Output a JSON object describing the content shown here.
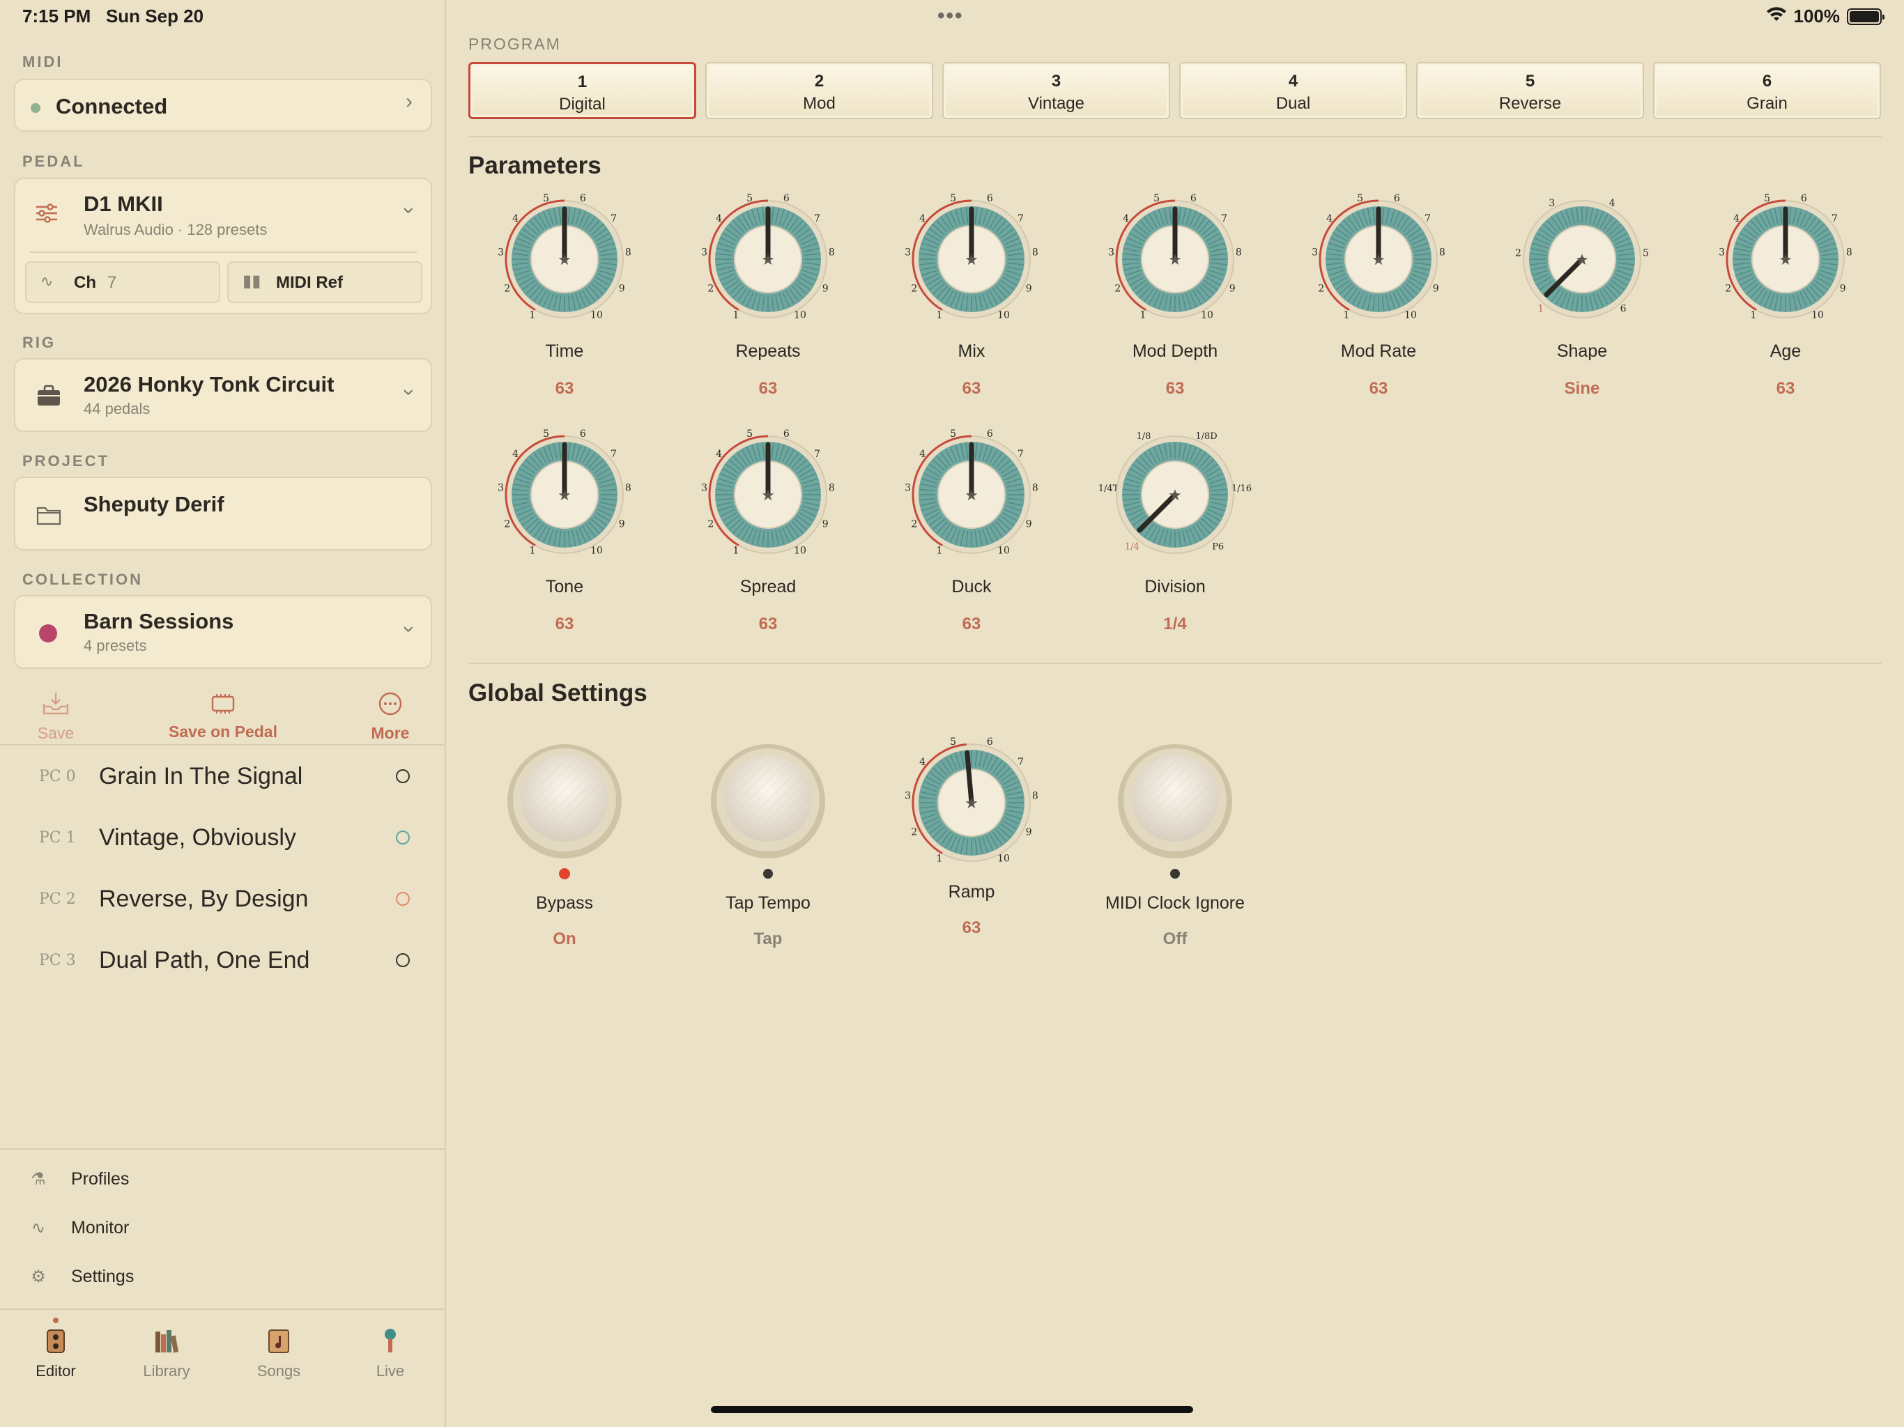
{
  "status": {
    "time": "7:15 PM",
    "date": "Sun Sep 20",
    "battery": "100%"
  },
  "sidebar": {
    "midi_label": "MIDI",
    "midi_status": "Connected",
    "pedal_label": "PEDAL",
    "pedal_name": "D1 MKII",
    "pedal_sub": "Walrus Audio · 128 presets",
    "ch_label": "Ch",
    "ch_value": "7",
    "midi_ref": "MIDI Ref",
    "rig_label": "RIG",
    "rig_name": "2026 Honky Tonk Circuit",
    "rig_sub": "44 pedals",
    "project_label": "PROJECT",
    "project_name": "Sheputy Derif",
    "collection_label": "COLLECTION",
    "collection_name": "Barn Sessions",
    "collection_sub": "4 presets",
    "actions": {
      "save": "Save",
      "save_on_pedal": "Save on Pedal",
      "more": "More"
    },
    "presets": [
      {
        "pc": "PC 0",
        "name": "Grain In The Signal",
        "color": "#3a3631"
      },
      {
        "pc": "PC 1",
        "name": "Vintage, Obviously",
        "color": "#5ba8a0"
      },
      {
        "pc": "PC 2",
        "name": "Reverse, By Design",
        "color": "#e08a6a"
      },
      {
        "pc": "PC 3",
        "name": "Dual Path, One End",
        "color": "#3a3631"
      }
    ],
    "nav": {
      "profiles": "Profiles",
      "monitor": "Monitor",
      "settings": "Settings"
    },
    "tabs": {
      "editor": "Editor",
      "library": "Library",
      "songs": "Songs",
      "live": "Live"
    }
  },
  "program": {
    "label": "PROGRAM",
    "buttons": [
      {
        "num": "1",
        "name": "Digital"
      },
      {
        "num": "2",
        "name": "Mod"
      },
      {
        "num": "3",
        "name": "Vintage"
      },
      {
        "num": "4",
        "name": "Dual"
      },
      {
        "num": "5",
        "name": "Reverse"
      },
      {
        "num": "6",
        "name": "Grain"
      }
    ]
  },
  "parameters": {
    "title": "Parameters",
    "knobs": [
      {
        "label": "Time",
        "value": "63"
      },
      {
        "label": "Repeats",
        "value": "63"
      },
      {
        "label": "Mix",
        "value": "63"
      },
      {
        "label": "Mod Depth",
        "value": "63"
      },
      {
        "label": "Mod Rate",
        "value": "63"
      },
      {
        "label": "Shape",
        "value": "Sine"
      },
      {
        "label": "Age",
        "value": "63"
      },
      {
        "label": "Tone",
        "value": "63"
      },
      {
        "label": "Spread",
        "value": "63"
      },
      {
        "label": "Duck",
        "value": "63"
      },
      {
        "label": "Division",
        "value": "1/4"
      }
    ],
    "scale_numbers": [
      "1",
      "2",
      "3",
      "4",
      "5",
      "6",
      "7",
      "8",
      "9",
      "10"
    ],
    "shape_scale": [
      "1",
      "2",
      "3",
      "4",
      "5",
      "6"
    ],
    "division_scale": [
      "1/4",
      "1/4T",
      "1/8",
      "1/8D",
      "1/16",
      "P6"
    ]
  },
  "global": {
    "title": "Global Settings",
    "bypass": {
      "label": "Bypass",
      "value": "On"
    },
    "tap": {
      "label": "Tap Tempo",
      "value": "Tap"
    },
    "ramp": {
      "label": "Ramp",
      "value": "63"
    },
    "clock": {
      "label": "MIDI Clock Ignore",
      "value": "Off"
    }
  },
  "colors": {
    "accent": "#c06c52",
    "active_border": "#c64a3a",
    "knob_teal": "#6fa7a0",
    "led_on": "#e0442e"
  }
}
